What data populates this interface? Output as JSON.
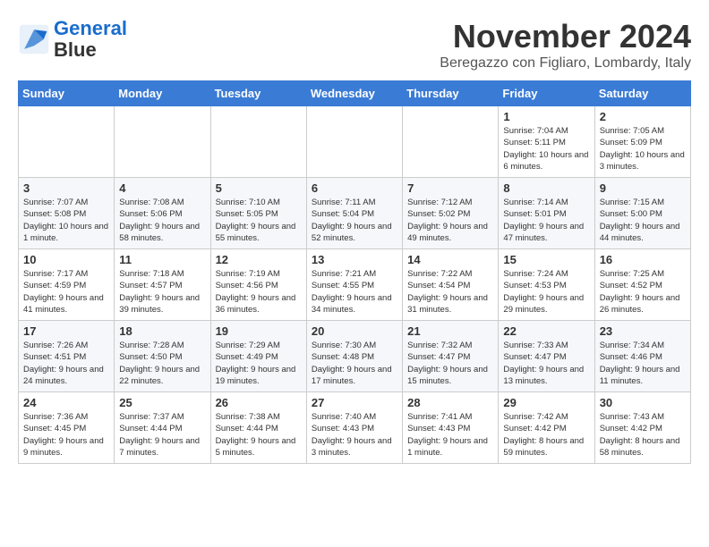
{
  "header": {
    "logo_line1": "General",
    "logo_line2": "Blue",
    "month": "November 2024",
    "location": "Beregazzo con Figliaro, Lombardy, Italy"
  },
  "weekdays": [
    "Sunday",
    "Monday",
    "Tuesday",
    "Wednesday",
    "Thursday",
    "Friday",
    "Saturday"
  ],
  "weeks": [
    [
      {
        "day": "",
        "info": ""
      },
      {
        "day": "",
        "info": ""
      },
      {
        "day": "",
        "info": ""
      },
      {
        "day": "",
        "info": ""
      },
      {
        "day": "",
        "info": ""
      },
      {
        "day": "1",
        "info": "Sunrise: 7:04 AM\nSunset: 5:11 PM\nDaylight: 10 hours and 6 minutes."
      },
      {
        "day": "2",
        "info": "Sunrise: 7:05 AM\nSunset: 5:09 PM\nDaylight: 10 hours and 3 minutes."
      }
    ],
    [
      {
        "day": "3",
        "info": "Sunrise: 7:07 AM\nSunset: 5:08 PM\nDaylight: 10 hours and 1 minute."
      },
      {
        "day": "4",
        "info": "Sunrise: 7:08 AM\nSunset: 5:06 PM\nDaylight: 9 hours and 58 minutes."
      },
      {
        "day": "5",
        "info": "Sunrise: 7:10 AM\nSunset: 5:05 PM\nDaylight: 9 hours and 55 minutes."
      },
      {
        "day": "6",
        "info": "Sunrise: 7:11 AM\nSunset: 5:04 PM\nDaylight: 9 hours and 52 minutes."
      },
      {
        "day": "7",
        "info": "Sunrise: 7:12 AM\nSunset: 5:02 PM\nDaylight: 9 hours and 49 minutes."
      },
      {
        "day": "8",
        "info": "Sunrise: 7:14 AM\nSunset: 5:01 PM\nDaylight: 9 hours and 47 minutes."
      },
      {
        "day": "9",
        "info": "Sunrise: 7:15 AM\nSunset: 5:00 PM\nDaylight: 9 hours and 44 minutes."
      }
    ],
    [
      {
        "day": "10",
        "info": "Sunrise: 7:17 AM\nSunset: 4:59 PM\nDaylight: 9 hours and 41 minutes."
      },
      {
        "day": "11",
        "info": "Sunrise: 7:18 AM\nSunset: 4:57 PM\nDaylight: 9 hours and 39 minutes."
      },
      {
        "day": "12",
        "info": "Sunrise: 7:19 AM\nSunset: 4:56 PM\nDaylight: 9 hours and 36 minutes."
      },
      {
        "day": "13",
        "info": "Sunrise: 7:21 AM\nSunset: 4:55 PM\nDaylight: 9 hours and 34 minutes."
      },
      {
        "day": "14",
        "info": "Sunrise: 7:22 AM\nSunset: 4:54 PM\nDaylight: 9 hours and 31 minutes."
      },
      {
        "day": "15",
        "info": "Sunrise: 7:24 AM\nSunset: 4:53 PM\nDaylight: 9 hours and 29 minutes."
      },
      {
        "day": "16",
        "info": "Sunrise: 7:25 AM\nSunset: 4:52 PM\nDaylight: 9 hours and 26 minutes."
      }
    ],
    [
      {
        "day": "17",
        "info": "Sunrise: 7:26 AM\nSunset: 4:51 PM\nDaylight: 9 hours and 24 minutes."
      },
      {
        "day": "18",
        "info": "Sunrise: 7:28 AM\nSunset: 4:50 PM\nDaylight: 9 hours and 22 minutes."
      },
      {
        "day": "19",
        "info": "Sunrise: 7:29 AM\nSunset: 4:49 PM\nDaylight: 9 hours and 19 minutes."
      },
      {
        "day": "20",
        "info": "Sunrise: 7:30 AM\nSunset: 4:48 PM\nDaylight: 9 hours and 17 minutes."
      },
      {
        "day": "21",
        "info": "Sunrise: 7:32 AM\nSunset: 4:47 PM\nDaylight: 9 hours and 15 minutes."
      },
      {
        "day": "22",
        "info": "Sunrise: 7:33 AM\nSunset: 4:47 PM\nDaylight: 9 hours and 13 minutes."
      },
      {
        "day": "23",
        "info": "Sunrise: 7:34 AM\nSunset: 4:46 PM\nDaylight: 9 hours and 11 minutes."
      }
    ],
    [
      {
        "day": "24",
        "info": "Sunrise: 7:36 AM\nSunset: 4:45 PM\nDaylight: 9 hours and 9 minutes."
      },
      {
        "day": "25",
        "info": "Sunrise: 7:37 AM\nSunset: 4:44 PM\nDaylight: 9 hours and 7 minutes."
      },
      {
        "day": "26",
        "info": "Sunrise: 7:38 AM\nSunset: 4:44 PM\nDaylight: 9 hours and 5 minutes."
      },
      {
        "day": "27",
        "info": "Sunrise: 7:40 AM\nSunset: 4:43 PM\nDaylight: 9 hours and 3 minutes."
      },
      {
        "day": "28",
        "info": "Sunrise: 7:41 AM\nSunset: 4:43 PM\nDaylight: 9 hours and 1 minute."
      },
      {
        "day": "29",
        "info": "Sunrise: 7:42 AM\nSunset: 4:42 PM\nDaylight: 8 hours and 59 minutes."
      },
      {
        "day": "30",
        "info": "Sunrise: 7:43 AM\nSunset: 4:42 PM\nDaylight: 8 hours and 58 minutes."
      }
    ]
  ]
}
